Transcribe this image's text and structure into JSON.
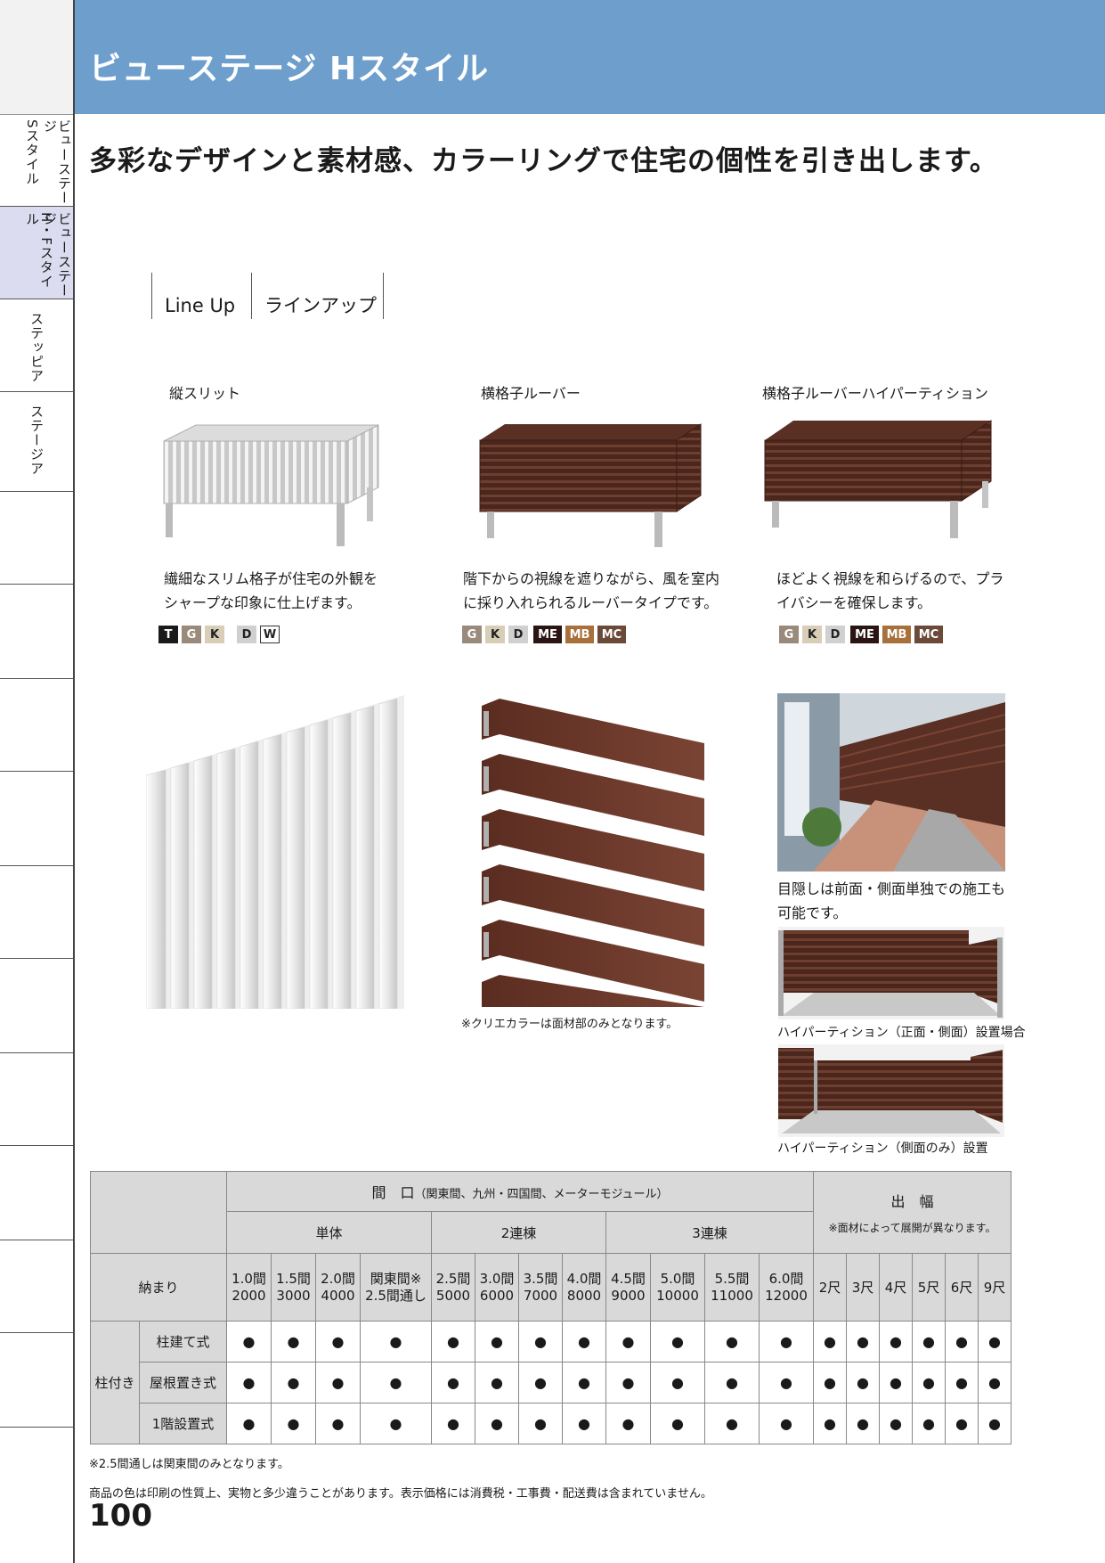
{
  "sidebar": {
    "tabs": [
      {
        "label_a": "ビューステージ",
        "label_b": "Sスタイル",
        "active": false
      },
      {
        "label_a": "ビューステージ",
        "label_b": "H・Fスタイル",
        "active": true
      },
      {
        "label_a": "ステッピア",
        "label_b": "",
        "active": false
      },
      {
        "label_a": "ステージア",
        "label_b": "",
        "active": false
      }
    ]
  },
  "header": {
    "title": "ビューステージ Hスタイル"
  },
  "headline": "多彩なデザインと素材感、カラーリングで住宅の個性を引き出します。",
  "lineup": {
    "en": "Line Up",
    "ja": "ラインアップ"
  },
  "products": [
    {
      "name": "縦スリット",
      "desc1": "繊細なスリム格子が住宅の外観を",
      "desc2": "シャープな印象に仕上げます。",
      "swatches": [
        {
          "code": "T",
          "bg": "#1a1a1a",
          "fg": "#ffffff",
          "border": "#1a1a1a"
        },
        {
          "code": "G",
          "bg": "#9a8a7c",
          "fg": "#ffffff",
          "border": "#9a8a7c"
        },
        {
          "code": "K",
          "bg": "#d8cdb6",
          "fg": "#222222",
          "border": "#d8cdb6"
        },
        {
          "code": "D",
          "bg": "#d0d0d0",
          "fg": "#222222",
          "border": "#d0d0d0"
        },
        {
          "code": "W",
          "bg": "#ffffff",
          "fg": "#222222",
          "border": "#333333"
        }
      ]
    },
    {
      "name": "横格子ルーバー",
      "desc1": "階下からの視線を遮りながら、風を室内",
      "desc2": "に採り入れられるルーバータイプです。",
      "swatches": [
        {
          "code": "G",
          "bg": "#9a8a7c",
          "fg": "#ffffff",
          "border": "#9a8a7c"
        },
        {
          "code": "K",
          "bg": "#d8cdb6",
          "fg": "#222222",
          "border": "#d8cdb6"
        },
        {
          "code": "D",
          "bg": "#d0d0d0",
          "fg": "#222222",
          "border": "#d0d0d0"
        },
        {
          "code": "ME",
          "bg": "#2a1414",
          "fg": "#ffffff",
          "border": "#2a1414"
        },
        {
          "code": "MB",
          "bg": "#a8703a",
          "fg": "#ffffff",
          "border": "#a8703a"
        },
        {
          "code": "MC",
          "bg": "#6b4a3a",
          "fg": "#ffffff",
          "border": "#6b4a3a"
        }
      ]
    },
    {
      "name": "横格子ルーバーハイパーティション",
      "desc1": "ほどよく視線を和らげるので、プラ",
      "desc2": "イバシーを確保します。",
      "swatches": [
        {
          "code": "G",
          "bg": "#9a8a7c",
          "fg": "#ffffff",
          "border": "#9a8a7c"
        },
        {
          "code": "K",
          "bg": "#d8cdb6",
          "fg": "#222222",
          "border": "#d8cdb6"
        },
        {
          "code": "D",
          "bg": "#d0d0d0",
          "fg": "#222222",
          "border": "#d0d0d0"
        },
        {
          "code": "ME",
          "bg": "#2a1414",
          "fg": "#ffffff",
          "border": "#2a1414"
        },
        {
          "code": "MB",
          "bg": "#a8703a",
          "fg": "#ffffff",
          "border": "#a8703a"
        },
        {
          "code": "MC",
          "bg": "#6b4a3a",
          "fg": "#ffffff",
          "border": "#6b4a3a"
        }
      ]
    }
  ],
  "captions": {
    "louver_note": "※クリエカラーは面材部のみとなります。",
    "partition_desc1": "目隠しは前面・側面単独での施工も",
    "partition_desc2": "可能です。",
    "photo1": "ハイパーティション（正面・側面）設置場合",
    "photo2": "ハイパーティション（側面のみ）設置"
  },
  "table": {
    "maguchi": "間　口",
    "maguchi_sub": "（関東間、九州・四国間、メーターモジュール）",
    "groups": [
      "単体",
      "2連棟",
      "3連棟"
    ],
    "depth_title": "出　幅",
    "depth_note": "※面材によって展開が異なります。",
    "osamari": "納まり",
    "spans": [
      {
        "a": "1.0間",
        "b": "2000"
      },
      {
        "a": "1.5間",
        "b": "3000"
      },
      {
        "a": "2.0間",
        "b": "4000"
      },
      {
        "a": "関東間※",
        "b": "2.5間通し"
      },
      {
        "a": "2.5間",
        "b": "5000"
      },
      {
        "a": "3.0間",
        "b": "6000"
      },
      {
        "a": "3.5間",
        "b": "7000"
      },
      {
        "a": "4.0間",
        "b": "8000"
      },
      {
        "a": "4.5間",
        "b": "9000"
      },
      {
        "a": "5.0間",
        "b": "10000"
      },
      {
        "a": "5.5間",
        "b": "11000"
      },
      {
        "a": "6.0間",
        "b": "12000"
      }
    ],
    "depths": [
      "2尺",
      "3尺",
      "4尺",
      "5尺",
      "6尺",
      "9尺"
    ],
    "row_group": "柱付き",
    "rows": [
      "柱建て式",
      "屋根置き式",
      "1階設置式"
    ],
    "dot": "●"
  },
  "notes": {
    "n1": "※2.5間通しは関東間のみとなります。",
    "n2": "商品の色は印刷の性質上、実物と多少違うことがあります。表示価格には消費税・工事費・配送費は含まれていません。"
  },
  "page_number": "100"
}
